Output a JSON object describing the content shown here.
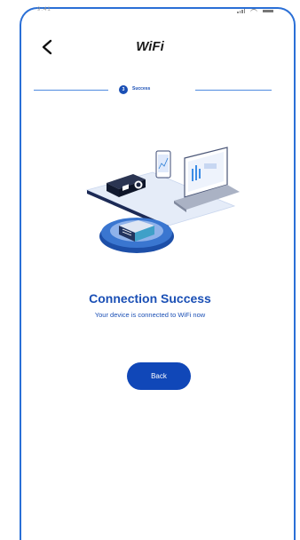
{
  "status_bar": {
    "time": "9:41"
  },
  "header": {
    "title": "WiFi"
  },
  "stepper": {
    "step_number": "3",
    "step_label": "Success"
  },
  "main": {
    "title": "Connection Success",
    "subtitle": "Your device is connected to WiFi now",
    "back_label": "Back"
  },
  "colors": {
    "accent": "#1a4fb5",
    "button": "#1047b8",
    "frame": "#2a6fd6"
  }
}
